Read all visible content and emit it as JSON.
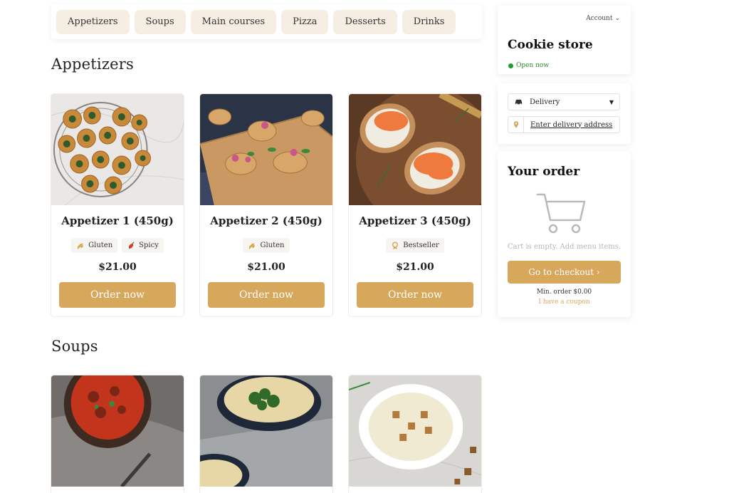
{
  "categories": [
    "Appetizers",
    "Soups",
    "Main courses",
    "Pizza",
    "Desserts",
    "Drinks"
  ],
  "sections": [
    {
      "title": "Appetizers",
      "items": [
        {
          "name": "Appetizer 1 (450g)",
          "price": "$21.00",
          "button": "Order now",
          "tags": [
            {
              "icon": "wheat-icon",
              "label": "Gluten"
            },
            {
              "icon": "chili-pepper-icon",
              "label": "Spicy"
            }
          ]
        },
        {
          "name": "Appetizer 2 (450g)",
          "price": "$21.00",
          "button": "Order now",
          "tags": [
            {
              "icon": "wheat-icon",
              "label": "Gluten"
            }
          ]
        },
        {
          "name": "Appetizer 3 (450g)",
          "price": "$21.00",
          "button": "Order now",
          "tags": [
            {
              "icon": "award-icon",
              "label": "Bestseller"
            }
          ]
        }
      ]
    },
    {
      "title": "Soups",
      "items": [
        {
          "name": "",
          "price": "",
          "button": "",
          "tags": []
        },
        {
          "name": "",
          "price": "",
          "button": "",
          "tags": []
        },
        {
          "name": "",
          "price": "",
          "button": "",
          "tags": []
        }
      ]
    }
  ],
  "store": {
    "account_label": "Account",
    "name": "Cookie store",
    "status": "Open now"
  },
  "delivery": {
    "selected": "Delivery",
    "address_placeholder": "Enter delivery address"
  },
  "order": {
    "title": "Your order",
    "empty_text": "Cart is empty. Add menu items.",
    "checkout_label": "Go to checkout ›",
    "min_order": "Min. order $0.00",
    "coupon_label": "I have a coupon"
  },
  "colors": {
    "accent": "#d7a85c",
    "chip_bg": "#f6eee3",
    "open_green": "#1f9a35"
  }
}
